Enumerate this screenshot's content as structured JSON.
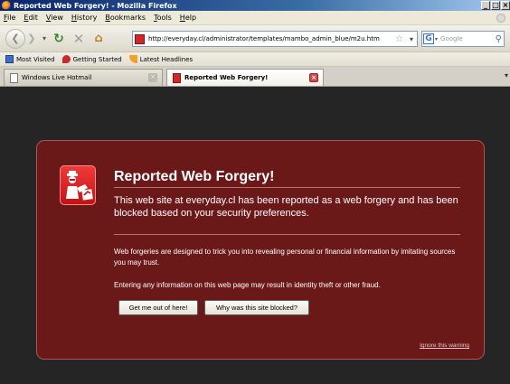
{
  "window": {
    "title": "Reported Web Forgery! - Mozilla Firefox",
    "controls": [
      "_",
      "□",
      "×"
    ]
  },
  "menu": [
    "File",
    "Edit",
    "View",
    "History",
    "Bookmarks",
    "Tools",
    "Help"
  ],
  "nav": {
    "url": "http://everyday.cl/administrator/templates/mambo_admin_blue/m2u.htm",
    "search_placeholder": "Google"
  },
  "bookmarks": [
    "Most Visited",
    "Getting Started",
    "Latest Headlines"
  ],
  "tabs": [
    {
      "label": "Windows Live Hotmail",
      "active": false
    },
    {
      "label": "Reported Web Forgery!",
      "active": true
    }
  ],
  "warning": {
    "title": "Reported Web Forgery!",
    "lead": "This web site at everyday.cl has been reported as a web forgery and has been blocked based on your security preferences.",
    "p1": "Web forgeries are designed to trick you into revealing personal or financial information by imitating sources you may trust.",
    "p2": "Entering any information on this web page may result in identity theft or other fraud.",
    "btn_out": "Get me out of here!",
    "btn_why": "Why was this site blocked?",
    "ignore": "Ignore this warning"
  },
  "colors": {
    "panel_bg": "#6b1818",
    "page_bg": "#252525",
    "badge_red": "#d42020"
  }
}
